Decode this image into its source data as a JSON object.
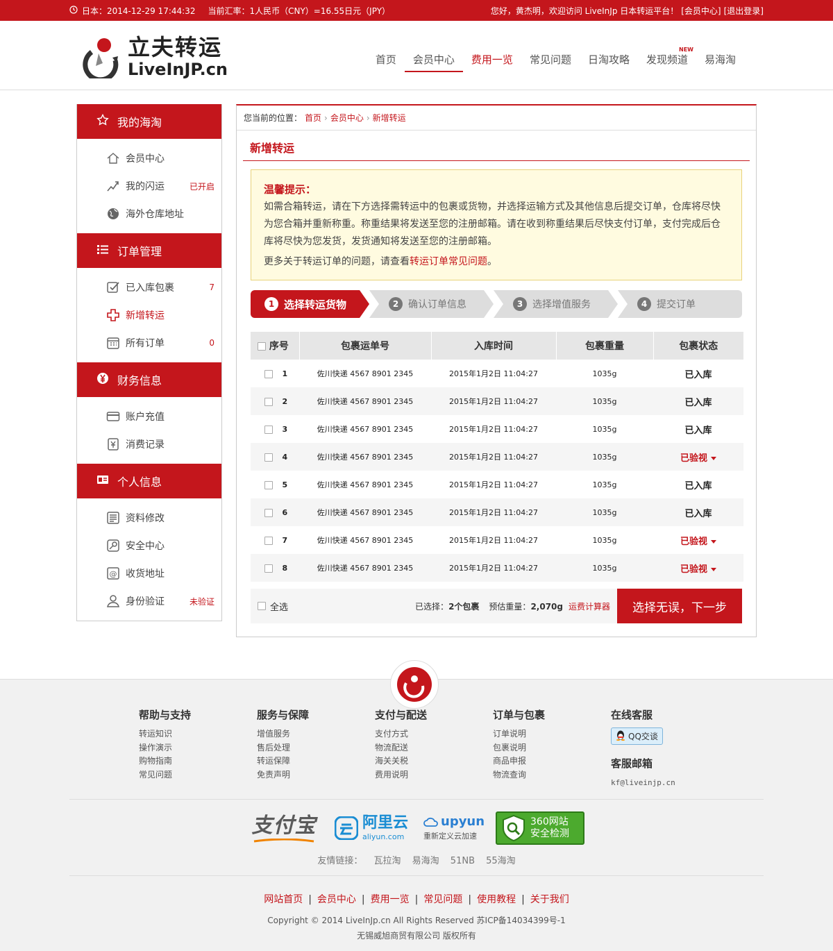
{
  "topbar": {
    "date": "日本：2014-12-29 17:44:32",
    "rate": "当前汇率：1人民币（CNY）=16.55日元（JPY）",
    "greeting": "您好，黄杰明，欢迎访问 LiveInJp 日本转运平台！",
    "member_link": "[会员中心]",
    "logout_link": "[退出登录]"
  },
  "logo": {
    "cn": "立夫转运",
    "en": "LiveInJP.cn"
  },
  "nav": [
    {
      "label": "首页"
    },
    {
      "label": "会员中心"
    },
    {
      "label": "费用一览"
    },
    {
      "label": "常见问题"
    },
    {
      "label": "日淘攻略"
    },
    {
      "label": "发现频道",
      "badge": "NEW"
    },
    {
      "label": "易海淘"
    }
  ],
  "sidebar": {
    "sections": [
      {
        "title": "我的海淘",
        "items": [
          {
            "label": "会员中心",
            "tag": ""
          },
          {
            "label": "我的闪运",
            "tag": "已开启"
          },
          {
            "label": "海外仓库地址",
            "tag": ""
          }
        ]
      },
      {
        "title": "订单管理",
        "items": [
          {
            "label": "已入库包裹",
            "tag": "7"
          },
          {
            "label": "新增转运",
            "tag": ""
          },
          {
            "label": "所有订单",
            "tag": "0"
          }
        ]
      },
      {
        "title": "财务信息",
        "items": [
          {
            "label": "账户充值",
            "tag": ""
          },
          {
            "label": "消费记录",
            "tag": ""
          }
        ]
      },
      {
        "title": "个人信息",
        "items": [
          {
            "label": "资料修改",
            "tag": ""
          },
          {
            "label": "安全中心",
            "tag": ""
          },
          {
            "label": "收货地址",
            "tag": ""
          },
          {
            "label": "身份验证",
            "tag": "未验证"
          }
        ]
      }
    ]
  },
  "breadcrumb": {
    "prefix": "您当前的位置：",
    "items": [
      "首页",
      "会员中心",
      "新增转运"
    ]
  },
  "page_title": "新增转运",
  "tip": {
    "heading": "温馨提示：",
    "body": "如需合箱转运，请在下方选择需转运中的包裹或货物，并选择运输方式及其他信息后提交订单，仓库将尽快为您合箱并重新称重。称重结果将发送至您的注册邮箱。请在收到称重结果后尽快支付订单，支付完成后仓库将尽快为您发货，发货通知将发送至您的注册邮箱。",
    "more_prefix": "更多关于转运订单的问题，请查看",
    "more_link": "转运订单常见问题",
    "more_suffix": "。"
  },
  "steps": [
    {
      "num": "1",
      "label": "选择转运货物"
    },
    {
      "num": "2",
      "label": "确认订单信息"
    },
    {
      "num": "3",
      "label": "选择增值服务"
    },
    {
      "num": "4",
      "label": "提交订单"
    }
  ],
  "table": {
    "headers": [
      "序号",
      "包裹运单号",
      "入库时间",
      "包裹重量",
      "包裹状态"
    ],
    "rows": [
      {
        "no": "1",
        "tracking": "佐川快递 4567 8901 2345",
        "time": "2015年1月2日 11:04:27",
        "weight": "1035g",
        "status": "已入库",
        "flag": false
      },
      {
        "no": "2",
        "tracking": "佐川快递 4567 8901 2345",
        "time": "2015年1月2日 11:04:27",
        "weight": "1035g",
        "status": "已入库",
        "flag": false
      },
      {
        "no": "3",
        "tracking": "佐川快递 4567 8901 2345",
        "time": "2015年1月2日 11:04:27",
        "weight": "1035g",
        "status": "已入库",
        "flag": false
      },
      {
        "no": "4",
        "tracking": "佐川快递 4567 8901 2345",
        "time": "2015年1月2日 11:04:27",
        "weight": "1035g",
        "status": "已验视",
        "flag": true
      },
      {
        "no": "5",
        "tracking": "佐川快递 4567 8901 2345",
        "time": "2015年1月2日 11:04:27",
        "weight": "1035g",
        "status": "已入库",
        "flag": false
      },
      {
        "no": "6",
        "tracking": "佐川快递 4567 8901 2345",
        "time": "2015年1月2日 11:04:27",
        "weight": "1035g",
        "status": "已入库",
        "flag": false
      },
      {
        "no": "7",
        "tracking": "佐川快递 4567 8901 2345",
        "time": "2015年1月2日 11:04:27",
        "weight": "1035g",
        "status": "已验视",
        "flag": true
      },
      {
        "no": "8",
        "tracking": "佐川快递 4567 8901 2345",
        "time": "2015年1月2日 11:04:27",
        "weight": "1035g",
        "status": "已验视",
        "flag": true
      }
    ]
  },
  "summary": {
    "select_all": "全选",
    "selected": "已选择：",
    "selected_value": "2个包裹",
    "est_weight": "预估重量：",
    "est_weight_value": "2,070g",
    "calculator": "运费计算器",
    "next_button": "选择无误，下一步"
  },
  "footer": {
    "columns": [
      {
        "title": "帮助与支持",
        "links": [
          "转运知识",
          "操作演示",
          "购物指南",
          "常见问题"
        ]
      },
      {
        "title": "服务与保障",
        "links": [
          "增值服务",
          "售后处理",
          "转运保障",
          "免责声明"
        ]
      },
      {
        "title": "支付与配送",
        "links": [
          "支付方式",
          "物流配送",
          "海关关税",
          "费用说明"
        ]
      },
      {
        "title": "订单与包裹",
        "links": [
          "订单说明",
          "包裹说明",
          "商品申报",
          "物流查询"
        ]
      }
    ],
    "online_service": "在线客服",
    "qq_label": "QQ交谈",
    "email_title": "客服邮箱",
    "email": "kf@liveinjp.cn",
    "partners": {
      "alipay": "支付宝",
      "aliyun": "阿里云",
      "aliyun_url": "aliyun.com",
      "upyun": "upyun",
      "upyun_sub": "重新定义云加速",
      "s360_a": "360网站",
      "s360_b": "安全检测"
    },
    "friend_prefix": "友情链接：",
    "friend_links": [
      "瓦拉淘",
      "易海淘",
      "51NB",
      "55海淘"
    ],
    "bottom_nav": [
      "网站首页",
      "会员中心",
      "费用一览",
      "常见问题",
      "使用教程",
      "关于我们"
    ],
    "copyright": "Copyright © 2014 LiveInJp.cn All Rights Reserved  苏ICP备14034399号-1",
    "company": "无锡威旭商贸有限公司  版权所有"
  },
  "colors": {
    "brand": "#c4161c",
    "tip_bg": "#fffbe0"
  }
}
